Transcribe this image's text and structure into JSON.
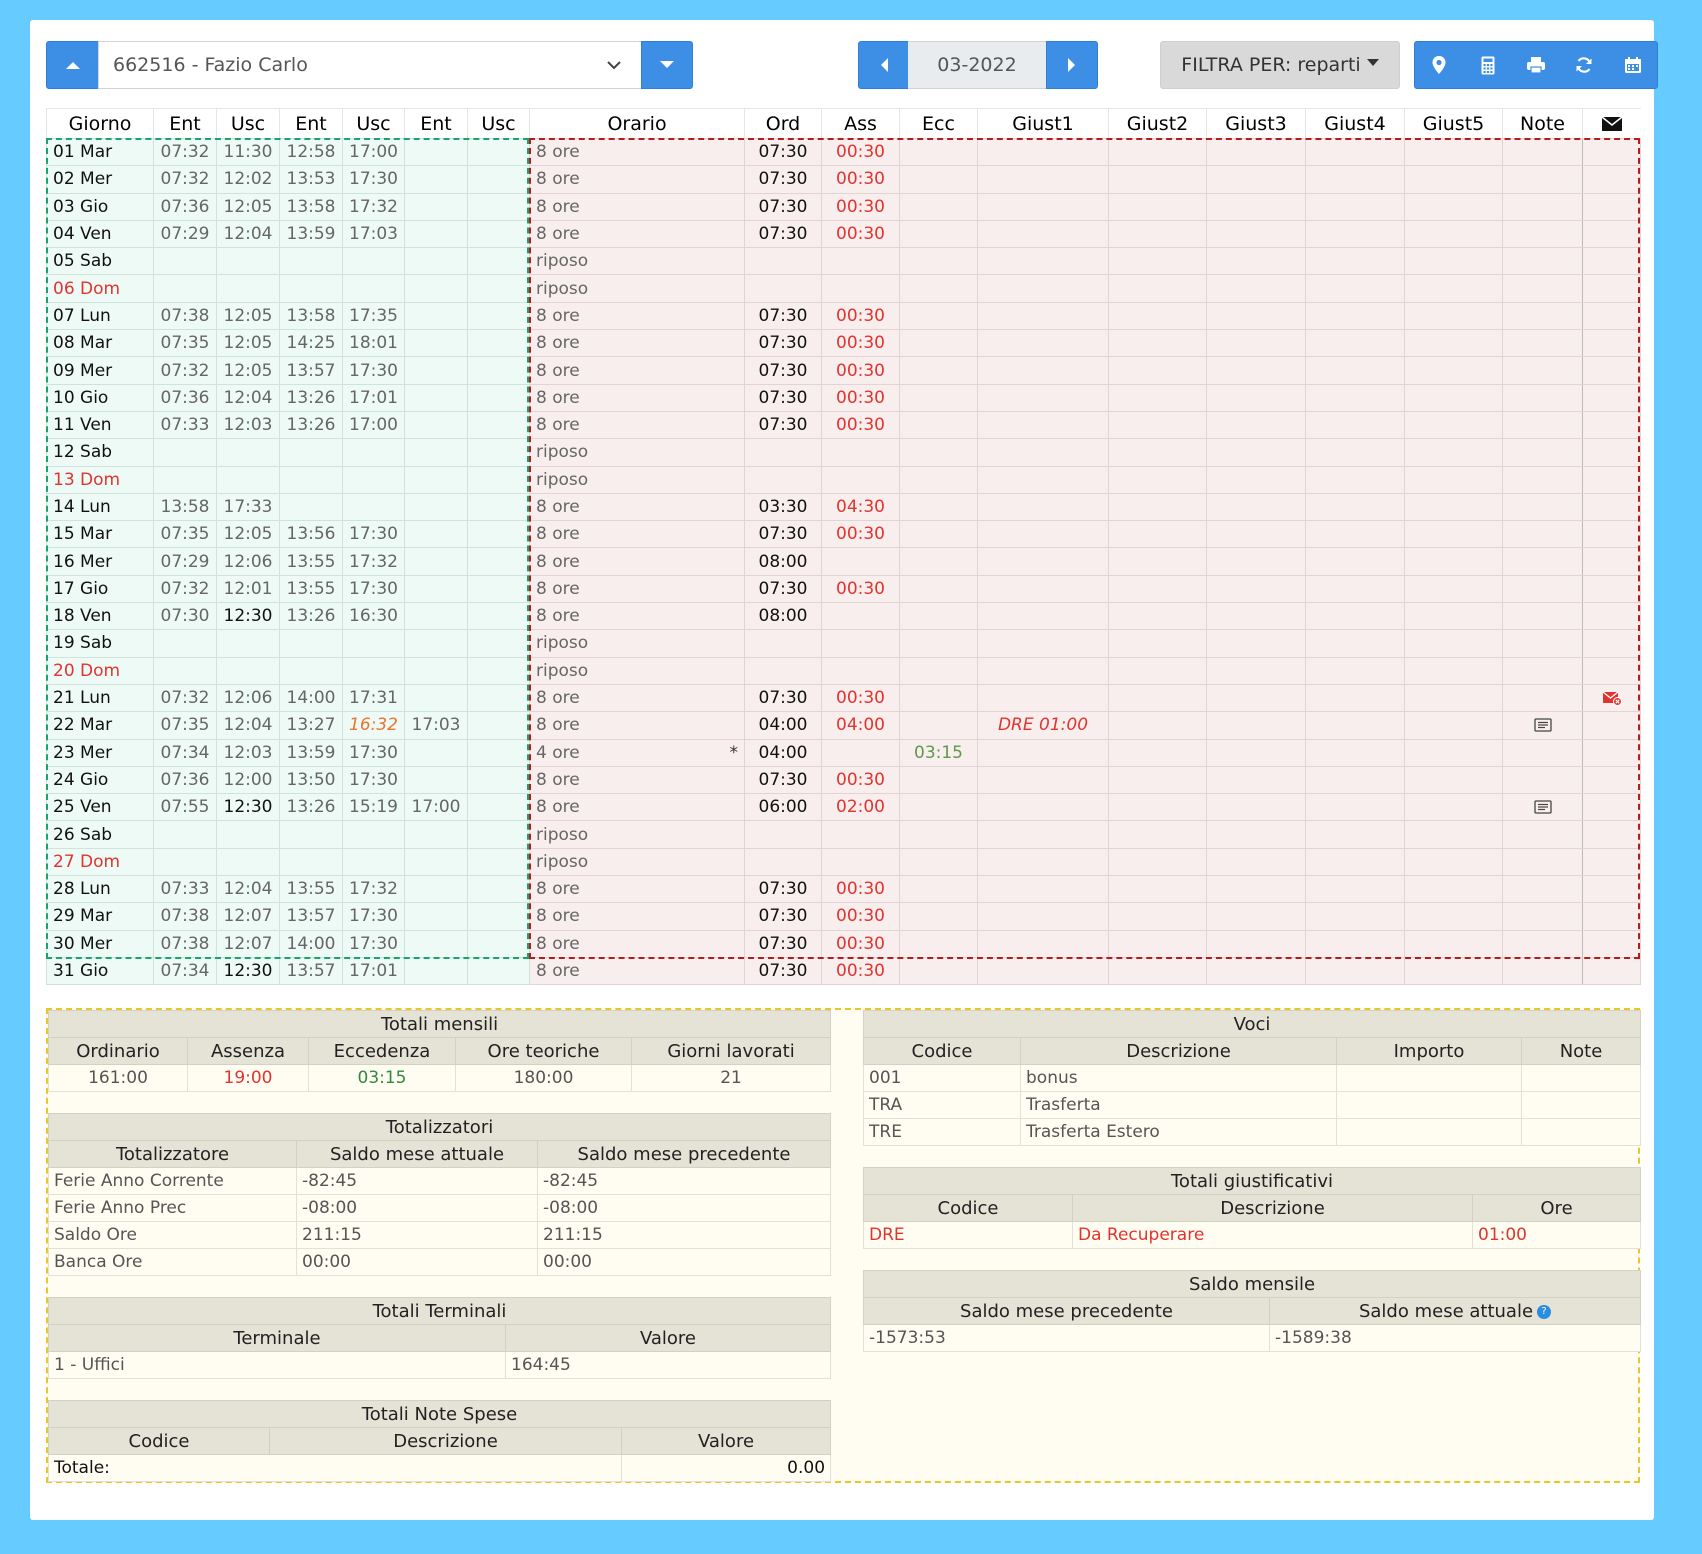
{
  "employee": {
    "selected": "662516 - Fazio Carlo"
  },
  "period": {
    "month": "03-2022"
  },
  "filter": {
    "label": "FILTRA PER: reparti"
  },
  "toolbar_icons": [
    "map-marker-icon",
    "calculator-icon",
    "print-icon",
    "refresh-icon",
    "calendar-icon"
  ],
  "main_table": {
    "headers": [
      "Giorno",
      "Ent",
      "Usc",
      "Ent",
      "Usc",
      "Ent",
      "Usc",
      "Orario",
      "Ord",
      "Ass",
      "Ecc",
      "Giust1",
      "Giust2",
      "Giust3",
      "Giust4",
      "Giust5",
      "Note"
    ],
    "rows": [
      {
        "day": "01 Mar",
        "t": [
          "07:32",
          "11:30",
          "12:58",
          "17:00",
          "",
          ""
        ],
        "orario": "8 ore",
        "ord": "07:30",
        "ass": "00:30"
      },
      {
        "day": "02 Mer",
        "t": [
          "07:32",
          "12:02",
          "13:53",
          "17:30",
          "",
          ""
        ],
        "orario": "8 ore",
        "ord": "07:30",
        "ass": "00:30"
      },
      {
        "day": "03 Gio",
        "t": [
          "07:36",
          "12:05",
          "13:58",
          "17:32",
          "",
          ""
        ],
        "orario": "8 ore",
        "ord": "07:30",
        "ass": "00:30"
      },
      {
        "day": "04 Ven",
        "t": [
          "07:29",
          "12:04",
          "13:59",
          "17:03",
          "",
          ""
        ],
        "orario": "8 ore",
        "ord": "07:30",
        "ass": "00:30"
      },
      {
        "day": "05 Sab",
        "t": [
          "",
          "",
          "",
          "",
          "",
          ""
        ],
        "orario": "riposo",
        "ord": "",
        "ass": ""
      },
      {
        "day": "06 Dom",
        "holiday": true,
        "t": [
          "",
          "",
          "",
          "",
          "",
          ""
        ],
        "orario": "riposo",
        "ord": "",
        "ass": ""
      },
      {
        "day": "07 Lun",
        "t": [
          "07:38",
          "12:05",
          "13:58",
          "17:35",
          "",
          ""
        ],
        "orario": "8 ore",
        "ord": "07:30",
        "ass": "00:30"
      },
      {
        "day": "08 Mar",
        "t": [
          "07:35",
          "12:05",
          "14:25",
          "18:01",
          "",
          ""
        ],
        "orario": "8 ore",
        "ord": "07:30",
        "ass": "00:30"
      },
      {
        "day": "09 Mer",
        "t": [
          "07:32",
          "12:05",
          "13:57",
          "17:30",
          "",
          ""
        ],
        "orario": "8 ore",
        "ord": "07:30",
        "ass": "00:30"
      },
      {
        "day": "10 Gio",
        "t": [
          "07:36",
          "12:04",
          "13:26",
          "17:01",
          "",
          ""
        ],
        "orario": "8 ore",
        "ord": "07:30",
        "ass": "00:30"
      },
      {
        "day": "11 Ven",
        "t": [
          "07:33",
          "12:03",
          "13:26",
          "17:00",
          "",
          ""
        ],
        "orario": "8 ore",
        "ord": "07:30",
        "ass": "00:30"
      },
      {
        "day": "12 Sab",
        "t": [
          "",
          "",
          "",
          "",
          "",
          ""
        ],
        "orario": "riposo",
        "ord": "",
        "ass": ""
      },
      {
        "day": "13 Dom",
        "holiday": true,
        "t": [
          "",
          "",
          "",
          "",
          "",
          ""
        ],
        "orario": "riposo",
        "ord": "",
        "ass": ""
      },
      {
        "day": "14 Lun",
        "t": [
          "13:58",
          "17:33",
          "",
          "",
          "",
          ""
        ],
        "orario": "8 ore",
        "ord": "03:30",
        "ass": "04:30"
      },
      {
        "day": "15 Mar",
        "t": [
          "07:35",
          "12:05",
          "13:56",
          "17:30",
          "",
          ""
        ],
        "orario": "8 ore",
        "ord": "07:30",
        "ass": "00:30"
      },
      {
        "day": "16 Mer",
        "t": [
          "07:29",
          "12:06",
          "13:55",
          "17:32",
          "",
          ""
        ],
        "orario": "8 ore",
        "ord": "08:00",
        "ass": ""
      },
      {
        "day": "17 Gio",
        "t": [
          "07:32",
          "12:01",
          "13:55",
          "17:30",
          "",
          ""
        ],
        "orario": "8 ore",
        "ord": "07:30",
        "ass": "00:30"
      },
      {
        "day": "18 Ven",
        "t": [
          "07:30",
          "12:30",
          "13:26",
          "16:30",
          "",
          ""
        ],
        "orario": "8 ore",
        "ord": "08:00",
        "ass": "",
        "dark": [
          1
        ]
      },
      {
        "day": "19 Sab",
        "t": [
          "",
          "",
          "",
          "",
          "",
          ""
        ],
        "orario": "riposo",
        "ord": "",
        "ass": ""
      },
      {
        "day": "20 Dom",
        "holiday": true,
        "t": [
          "",
          "",
          "",
          "",
          "",
          ""
        ],
        "orario": "riposo",
        "ord": "",
        "ass": ""
      },
      {
        "day": "21 Lun",
        "t": [
          "07:32",
          "12:06",
          "14:00",
          "17:31",
          "",
          ""
        ],
        "orario": "8 ore",
        "ord": "07:30",
        "ass": "00:30",
        "mail": true
      },
      {
        "day": "22 Mar",
        "t": [
          "07:35",
          "12:04",
          "13:27",
          "16:32",
          "17:03",
          ""
        ],
        "orario": "8 ore",
        "ord": "04:00",
        "ass": "04:00",
        "giust1": "DRE 01:00",
        "note": true,
        "orange": [
          3
        ]
      },
      {
        "day": "23 Mer",
        "t": [
          "07:34",
          "12:03",
          "13:59",
          "17:30",
          "",
          ""
        ],
        "orario": "4 ore",
        "star": "*",
        "ord": "04:00",
        "ass": "",
        "ecc": "03:15"
      },
      {
        "day": "24 Gio",
        "t": [
          "07:36",
          "12:00",
          "13:50",
          "17:30",
          "",
          ""
        ],
        "orario": "8 ore",
        "ord": "07:30",
        "ass": "00:30"
      },
      {
        "day": "25 Ven",
        "t": [
          "07:55",
          "12:30",
          "13:26",
          "15:19",
          "17:00",
          ""
        ],
        "orario": "8 ore",
        "ord": "06:00",
        "ass": "02:00",
        "note": true,
        "dark": [
          1
        ]
      },
      {
        "day": "26 Sab",
        "t": [
          "",
          "",
          "",
          "",
          "",
          ""
        ],
        "orario": "riposo",
        "ord": "",
        "ass": ""
      },
      {
        "day": "27 Dom",
        "holiday": true,
        "t": [
          "",
          "",
          "",
          "",
          "",
          ""
        ],
        "orario": "riposo",
        "ord": "",
        "ass": ""
      },
      {
        "day": "28 Lun",
        "t": [
          "07:33",
          "12:04",
          "13:55",
          "17:32",
          "",
          ""
        ],
        "orario": "8 ore",
        "ord": "07:30",
        "ass": "00:30"
      },
      {
        "day": "29 Mar",
        "t": [
          "07:38",
          "12:07",
          "13:57",
          "17:30",
          "",
          ""
        ],
        "orario": "8 ore",
        "ord": "07:30",
        "ass": "00:30"
      },
      {
        "day": "30 Mer",
        "t": [
          "07:38",
          "12:07",
          "14:00",
          "17:30",
          "",
          ""
        ],
        "orario": "8 ore",
        "ord": "07:30",
        "ass": "00:30"
      },
      {
        "day": "31 Gio",
        "t": [
          "07:34",
          "12:30",
          "13:57",
          "17:01",
          "",
          ""
        ],
        "orario": "8 ore",
        "ord": "07:30",
        "ass": "00:30",
        "dark": [
          1
        ]
      }
    ]
  },
  "totali_mensili": {
    "title": "Totali mensili",
    "headers": [
      "Ordinario",
      "Assenza",
      "Eccedenza",
      "Ore teoriche",
      "Giorni lavorati"
    ],
    "values": [
      "161:00",
      "19:00",
      "03:15",
      "180:00",
      "21"
    ]
  },
  "totalizzatori": {
    "title": "Totalizzatori",
    "headers": [
      "Totalizzatore",
      "Saldo mese attuale",
      "Saldo mese precedente"
    ],
    "rows": [
      [
        "Ferie Anno Corrente",
        "-82:45",
        "-82:45"
      ],
      [
        "Ferie Anno Prec",
        "-08:00",
        "-08:00"
      ],
      [
        "Saldo Ore",
        "211:15",
        "211:15"
      ],
      [
        "Banca Ore",
        "00:00",
        "00:00"
      ]
    ]
  },
  "totali_terminali": {
    "title": "Totali Terminali",
    "headers": [
      "Terminale",
      "Valore"
    ],
    "rows": [
      [
        "1 - Uffici",
        "164:45"
      ]
    ]
  },
  "totali_note_spese": {
    "title": "Totali Note Spese",
    "headers": [
      "Codice",
      "Descrizione",
      "Valore"
    ],
    "total_label": "Totale:",
    "total_value": "0.00"
  },
  "voci": {
    "title": "Voci",
    "headers": [
      "Codice",
      "Descrizione",
      "Importo",
      "Note"
    ],
    "rows": [
      [
        "001",
        "bonus",
        "",
        ""
      ],
      [
        "TRA",
        "Trasferta",
        "",
        ""
      ],
      [
        "TRE",
        "Trasferta Estero",
        "",
        ""
      ]
    ]
  },
  "totali_giustificativi": {
    "title": "Totali giustificativi",
    "headers": [
      "Codice",
      "Descrizione",
      "Ore"
    ],
    "rows": [
      [
        "DRE",
        "Da Recuperare",
        "01:00"
      ]
    ]
  },
  "saldo_mensile": {
    "title": "Saldo mensile",
    "headers": [
      "Saldo mese precedente",
      "Saldo mese attuale"
    ],
    "values": [
      "-1573:53",
      "-1589:38"
    ]
  },
  "colors": {
    "background": "#66ccff",
    "primary": "#3d8fe6",
    "alert": "#e0342f",
    "positive": "#5b9b4a"
  }
}
